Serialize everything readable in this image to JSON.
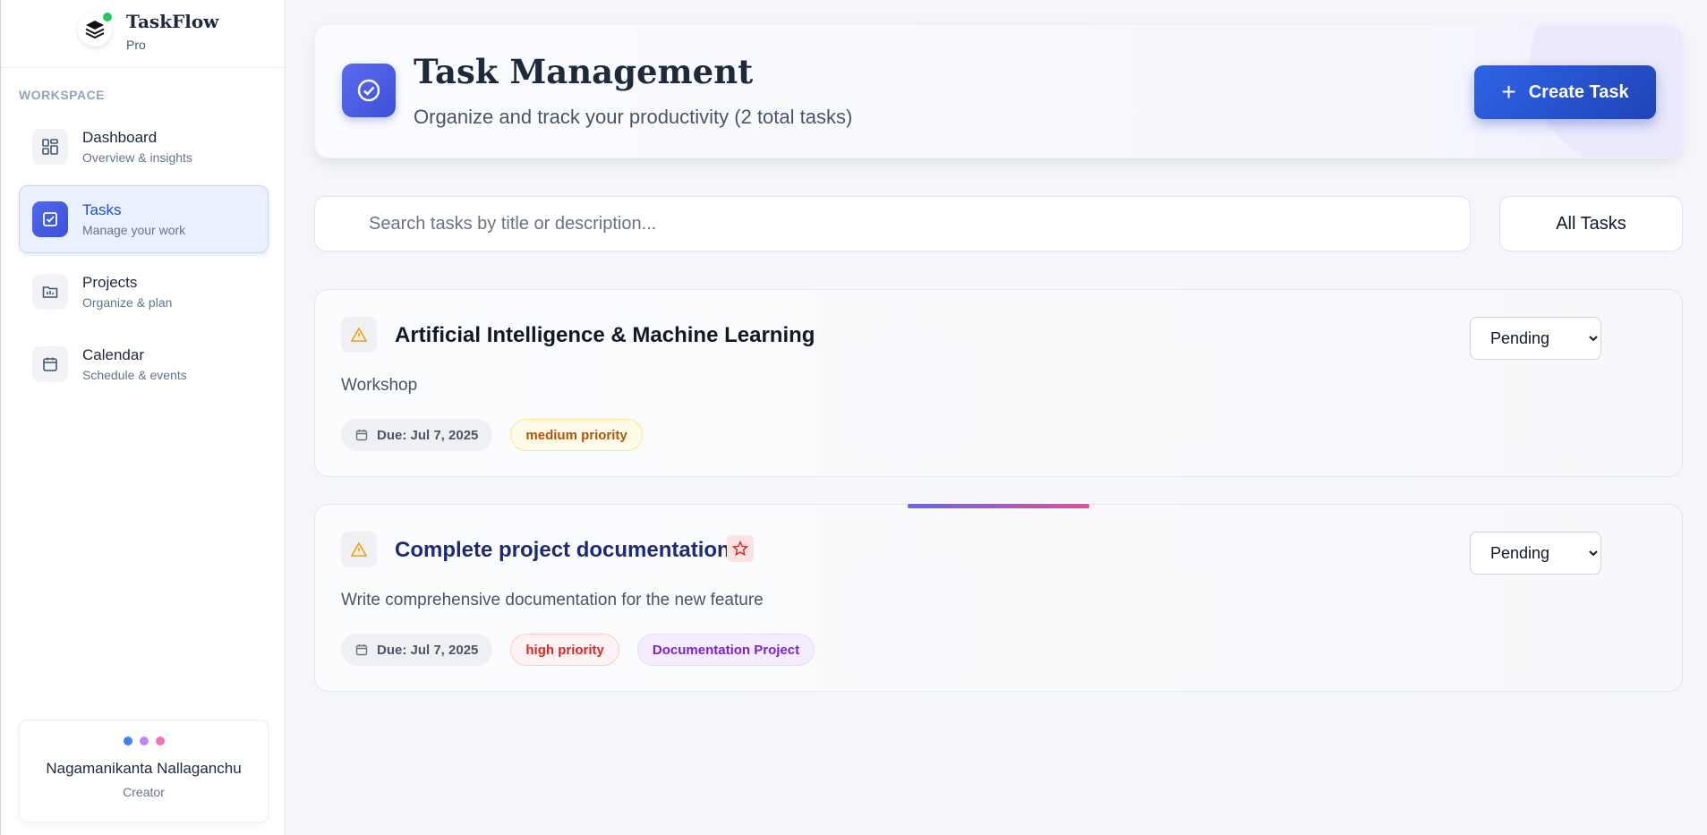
{
  "brand": {
    "name": "TaskFlow",
    "tier": "Pro"
  },
  "sidebar": {
    "section_label": "WORKSPACE",
    "items": [
      {
        "title": "Dashboard",
        "subtitle": "Overview & insights",
        "icon": "dashboard-grid-icon",
        "active": false
      },
      {
        "title": "Tasks",
        "subtitle": "Manage your work",
        "icon": "check-square-icon",
        "active": true
      },
      {
        "title": "Projects",
        "subtitle": "Organize & plan",
        "icon": "folder-chart-icon",
        "active": false
      },
      {
        "title": "Calendar",
        "subtitle": "Schedule & events",
        "icon": "calendar-icon",
        "active": false
      }
    ],
    "creator": {
      "name": "Nagamanikanta Nallaganchu",
      "role": "Creator",
      "dot_colors": [
        "#3b82f6",
        "#c084fc",
        "#f472b6"
      ]
    }
  },
  "header": {
    "title": "Task Management",
    "subtitle": "Organize and track your productivity (2 total tasks)",
    "create_label": "Create Task"
  },
  "search": {
    "placeholder": "Search tasks by title or description...",
    "value": ""
  },
  "filter": {
    "label": "All Tasks"
  },
  "tasks": [
    {
      "title": "Artificial Intelligence & Machine Learning",
      "description": "Workshop",
      "due": "Due: Jul 7, 2025",
      "priority": "medium priority",
      "project": null,
      "status": "Pending",
      "starred": false
    },
    {
      "title": "Complete project documentation",
      "description": "Write comprehensive documentation for the new feature",
      "due": "Due: Jul 7, 2025",
      "priority": "high priority",
      "project": "Documentation Project",
      "status": "Pending",
      "starred": true
    }
  ],
  "status_options": [
    "Pending"
  ],
  "colors": {
    "accent": "#2f63e6",
    "active_nav": "#1d4ed8",
    "medium_priority": "#b45309",
    "high_priority": "#dc2626",
    "project": "#7e22ce"
  }
}
